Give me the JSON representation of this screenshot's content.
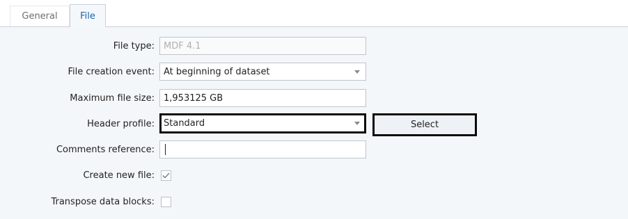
{
  "tabs": {
    "general": "General",
    "file": "File"
  },
  "form": {
    "file_type": {
      "label": "File type:",
      "value": "MDF 4.1"
    },
    "file_creation_event": {
      "label": "File creation event:",
      "value": "At beginning of dataset"
    },
    "max_file_size": {
      "label": "Maximum file size:",
      "value": "1,953125 GB"
    },
    "header_profile": {
      "label": "Header profile:",
      "value": "Standard"
    },
    "comments_reference": {
      "label": "Comments reference:",
      "value": ""
    },
    "select_button": "Select",
    "create_new_file": {
      "label": "Create new file:",
      "checked": true
    },
    "transpose_data_blocks": {
      "label": "Transpose data blocks:",
      "checked": false
    }
  },
  "colors": {
    "active_tab_text": "#1c62a8",
    "panel_background": "#f4f7fa",
    "highlight_border": "#0a0a0a"
  },
  "icons": {
    "dropdown": "chevron-down-icon",
    "check": "checkmark-icon"
  }
}
